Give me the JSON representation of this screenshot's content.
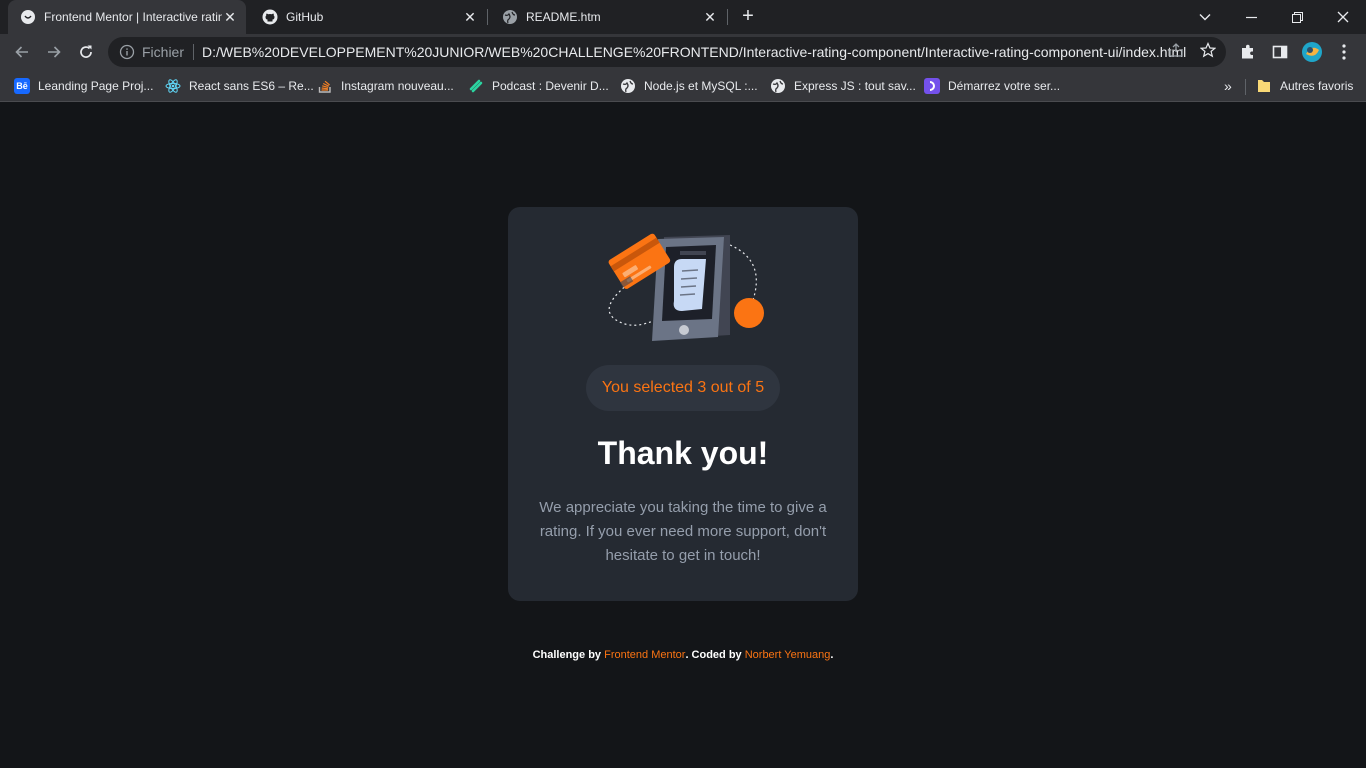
{
  "browser": {
    "tabs": [
      {
        "title": "Frontend Mentor | Interactive rating component",
        "icon": "frontend-mentor-favicon",
        "active": true
      },
      {
        "title": "GitHub",
        "icon": "github-icon",
        "active": false
      },
      {
        "title": "README.htm",
        "icon": "globe-icon",
        "active": false
      }
    ],
    "new_tab": "+",
    "address": {
      "scheme_label": "Fichier",
      "url": "D:/WEB%20DEVELOPPEMENT%20JUNIOR/WEB%20CHALLENGE%20FRONTEND/Interactive-rating-component/Interactive-rating-component-ui/index.html"
    },
    "bookmarks": [
      {
        "label": "Leanding Page Proj...",
        "icon": "behance-icon",
        "icon_text": "Bē"
      },
      {
        "label": "React sans ES6 – Re...",
        "icon": "react-icon"
      },
      {
        "label": "Instagram nouveau...",
        "icon": "stackoverflow-icon"
      },
      {
        "label": "Podcast : Devenir D...",
        "icon": "podcast-icon"
      },
      {
        "label": "Node.js et MySQL :...",
        "icon": "globe-icon"
      },
      {
        "label": "Express JS : tout sav...",
        "icon": "globe-icon"
      },
      {
        "label": "Démarrez votre ser...",
        "icon": "openclassrooms-icon"
      }
    ],
    "other_bookmarks": "Autres favoris",
    "more_bookmarks": "»"
  },
  "card": {
    "selection_text": "You selected 3 out of 5",
    "title": "Thank you!",
    "message": "We appreciate you taking the time to give a rating. If you ever need more support, don't hesitate to get in touch!"
  },
  "attribution": {
    "prefix": "Challenge by ",
    "link1": "Frontend Mentor",
    "middle": ". Coded by ",
    "link2": "Norbert Yemuang",
    "suffix": "."
  },
  "colors": {
    "accent": "#fb7413",
    "card_bg": "#252a32",
    "page_bg": "#131518",
    "muted_text": "#959eac"
  }
}
